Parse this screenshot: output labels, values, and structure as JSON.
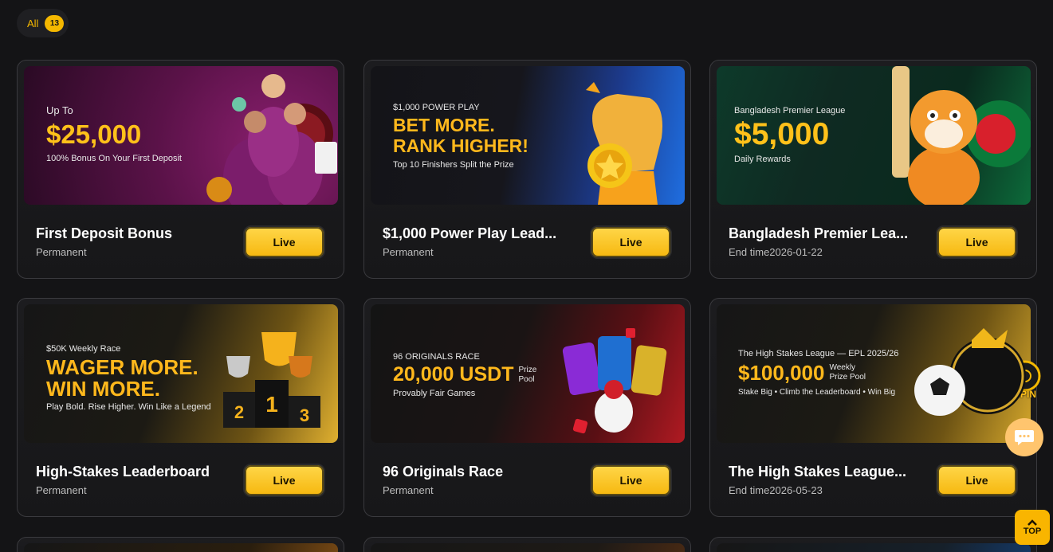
{
  "filter": {
    "label": "All",
    "count": "13"
  },
  "cards": [
    {
      "title": "First Deposit Bonus",
      "subtitle": "Permanent",
      "button": "Live",
      "banner": {
        "line1": "Up To",
        "headline": "$25,000",
        "line2": "100% Bonus On Your First Deposit"
      }
    },
    {
      "title": "$1,000 Power Play Lead...",
      "subtitle": "Permanent",
      "button": "Live",
      "banner": {
        "line1": "$1,000 POWER PLAY",
        "headline1": "BET MORE.",
        "headline2": "RANK HIGHER!",
        "line2": "Top 10 Finishers Split the Prize"
      }
    },
    {
      "title": "Bangladesh Premier Lea...",
      "subtitle": "End time2026-01-22",
      "button": "Live",
      "banner": {
        "line1": "Bangladesh Premier League",
        "headline": "$5,000",
        "line2": "Daily Rewards"
      }
    },
    {
      "title": "High-Stakes Leaderboard",
      "subtitle": "Permanent",
      "button": "Live",
      "banner": {
        "line1": "$50K Weekly Race",
        "headline1": "WAGER MORE.",
        "headline2": "WIN MORE.",
        "line2": "Play Bold. Rise Higher. Win Like a Legend"
      }
    },
    {
      "title": "96 Originals Race",
      "subtitle": "Permanent",
      "button": "Live",
      "banner": {
        "line1": "96 ORIGINALS RACE",
        "headline": "20,000 USDT",
        "side1": "Prize",
        "side2": "Pool",
        "line2": "Provably Fair Games"
      }
    },
    {
      "title": "The High Stakes League...",
      "subtitle": "End time2026-05-23",
      "button": "Live",
      "banner": {
        "line1": "The High Stakes League — EPL 2025/26",
        "headline": "$100,000",
        "side1": "Weekly",
        "side2": "Prize Pool",
        "line2": "Stake Big • Climb the Leaderboard • Win Big"
      }
    }
  ],
  "floating": {
    "spin_label": "SPIN",
    "top_label": "TOP"
  },
  "colors": {
    "accent": "#f5b800",
    "background": "#141416"
  }
}
